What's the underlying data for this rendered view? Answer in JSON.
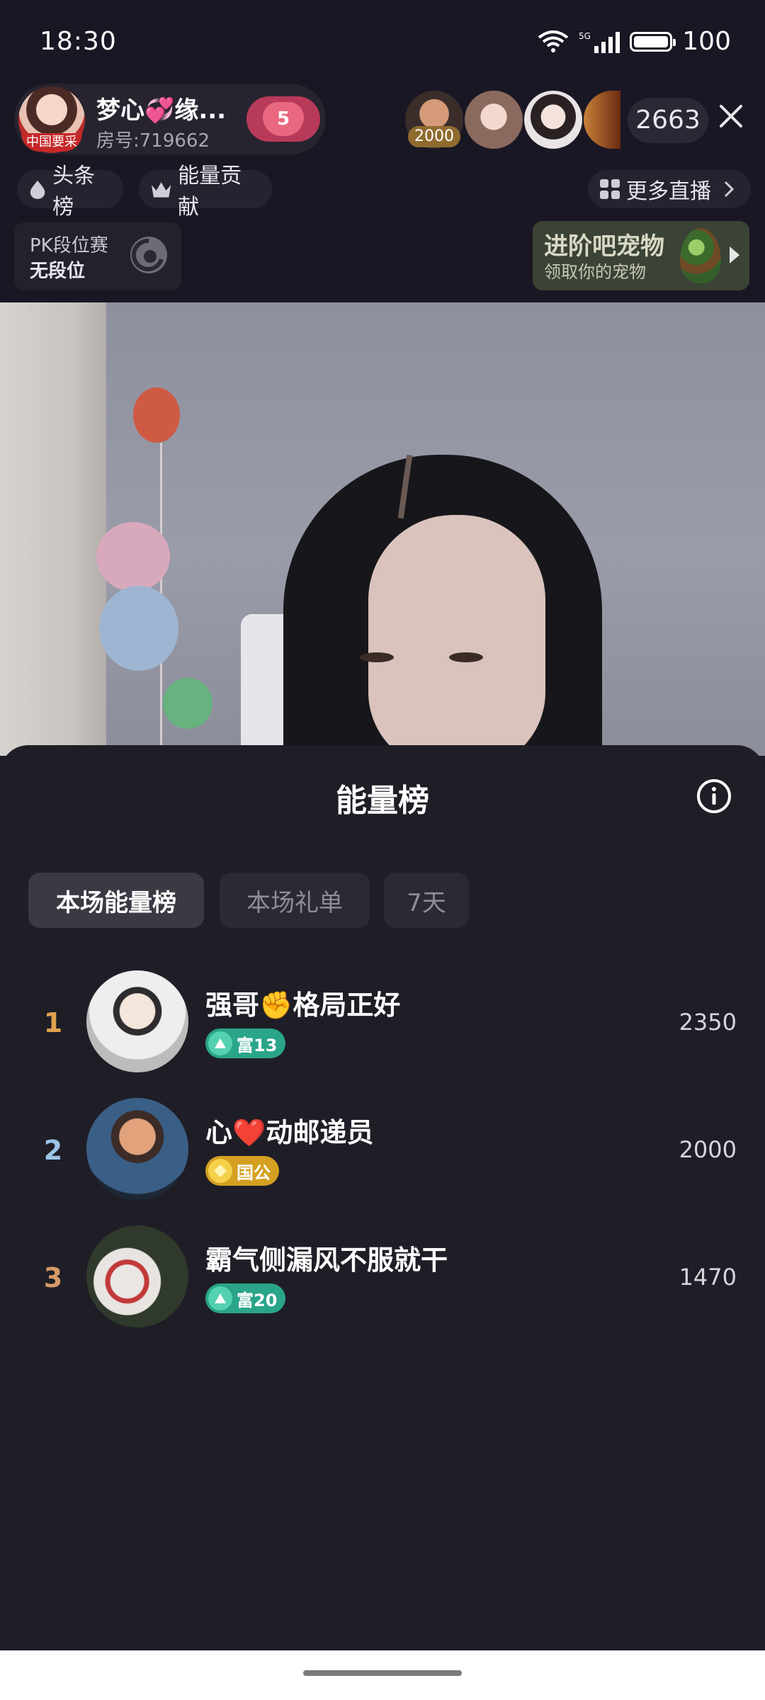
{
  "status_bar": {
    "time": "18:30",
    "battery": "100"
  },
  "host": {
    "name": "梦心💞缘...",
    "room": "房号:719662",
    "avatar_tag": "中国要采",
    "heart_level": "5"
  },
  "viewers": {
    "first_tag": "2000",
    "count": "2663"
  },
  "chips": {
    "headline_board": "头条榜",
    "energy_contribution": "能量贡献",
    "more_live": "更多直播"
  },
  "pk": {
    "title": "PK段位赛",
    "rank": "无段位"
  },
  "pet": {
    "title": "进阶吧宠物",
    "subtitle": "领取你的宠物"
  },
  "sheet": {
    "title": "能量榜",
    "tabs": [
      {
        "label": "本场能量榜",
        "active": true
      },
      {
        "label": "本场礼单",
        "active": false
      },
      {
        "label": "7天",
        "active": false
      }
    ],
    "rows": [
      {
        "rank": "1",
        "rank_color": "#e0a24e",
        "name": "强哥✊格局正好",
        "badge": "富13",
        "badge_color": "#2aa58a",
        "score": "2350"
      },
      {
        "rank": "2",
        "rank_color": "#9cc4e6",
        "name": "心❤️动邮递员",
        "badge": "国公",
        "badge_color": "#d4a021",
        "score": "2000"
      },
      {
        "rank": "3",
        "rank_color": "#d79a68",
        "name": "霸气侧漏风不服就干",
        "badge": "富20",
        "badge_color": "#2aa58a",
        "score": "1470"
      }
    ]
  }
}
